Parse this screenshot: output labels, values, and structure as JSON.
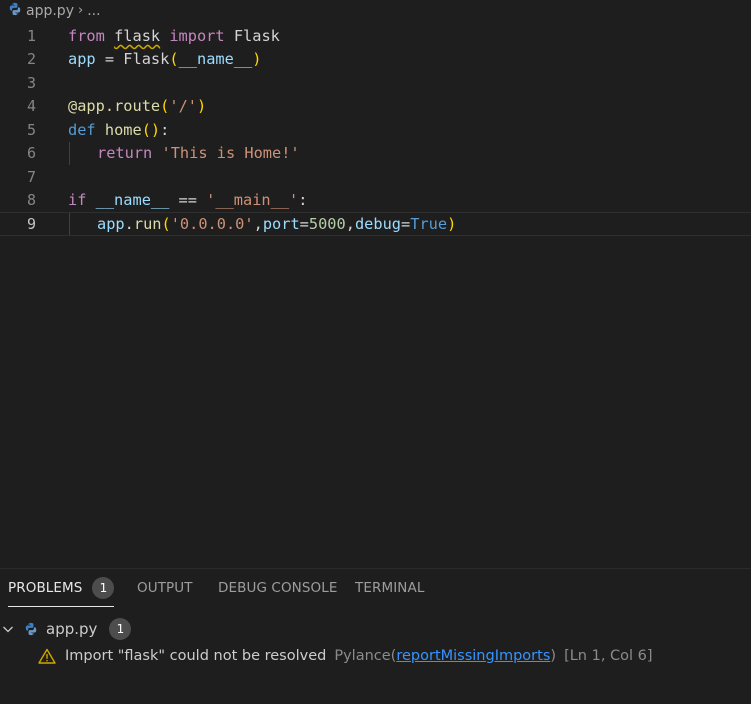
{
  "breadcrumb": {
    "file": "app.py",
    "more": "..."
  },
  "editor": {
    "line_numbers": [
      "1",
      "2",
      "3",
      "4",
      "5",
      "6",
      "7",
      "8",
      "9"
    ],
    "lines": {
      "l1": {
        "from": "from",
        "flask": "flask",
        "import": "import",
        "Flask": "Flask"
      },
      "l2": {
        "app": "app",
        "eq": " = ",
        "Flask": "Flask",
        "po": "(",
        "name": "__name__",
        "pc": ")"
      },
      "l4": {
        "at": "@",
        "app": "app",
        "dot": ".",
        "route": "route",
        "po": "(",
        "s": "'/'",
        "pc": ")"
      },
      "l5": {
        "def": "def",
        "home": "home",
        "po": "(",
        "pc": ")",
        "colon": ":"
      },
      "l6": {
        "return": "return",
        "s": "'This is Home!'"
      },
      "l8": {
        "if": "if",
        "name": "__name__",
        "eq": " == ",
        "s": "'__main__'",
        "colon": ":"
      },
      "l9": {
        "app": "app",
        "dot": ".",
        "run": "run",
        "po": "(",
        "s": "'0.0.0.0'",
        "comma1": ",",
        "port": "port",
        "eq1": "=",
        "num": "5000",
        "comma2": ",",
        "debug": "debug",
        "eq2": "=",
        "true": "True",
        "pc": ")"
      }
    }
  },
  "panel": {
    "tabs": {
      "problems": "PROBLEMS",
      "problems_count": "1",
      "output": "OUTPUT",
      "debug_console": "DEBUG CONSOLE",
      "terminal": "TERMINAL"
    },
    "problems": {
      "file": "app.py",
      "file_count": "1",
      "message": "Import \"flask\" could not be resolved",
      "source": "Pylance",
      "rule_open": "(",
      "rule": "reportMissingImports",
      "rule_close": ")",
      "position": "[Ln 1, Col 6]"
    }
  },
  "colors": {
    "background": "#1e1e1e",
    "keyword": "#569cd6",
    "control": "#c586c0",
    "function": "#dcdcaa",
    "variable": "#9cdcfe",
    "string": "#ce9178",
    "number": "#b5cea8",
    "warning": "#cca700",
    "link": "#3794ff"
  }
}
